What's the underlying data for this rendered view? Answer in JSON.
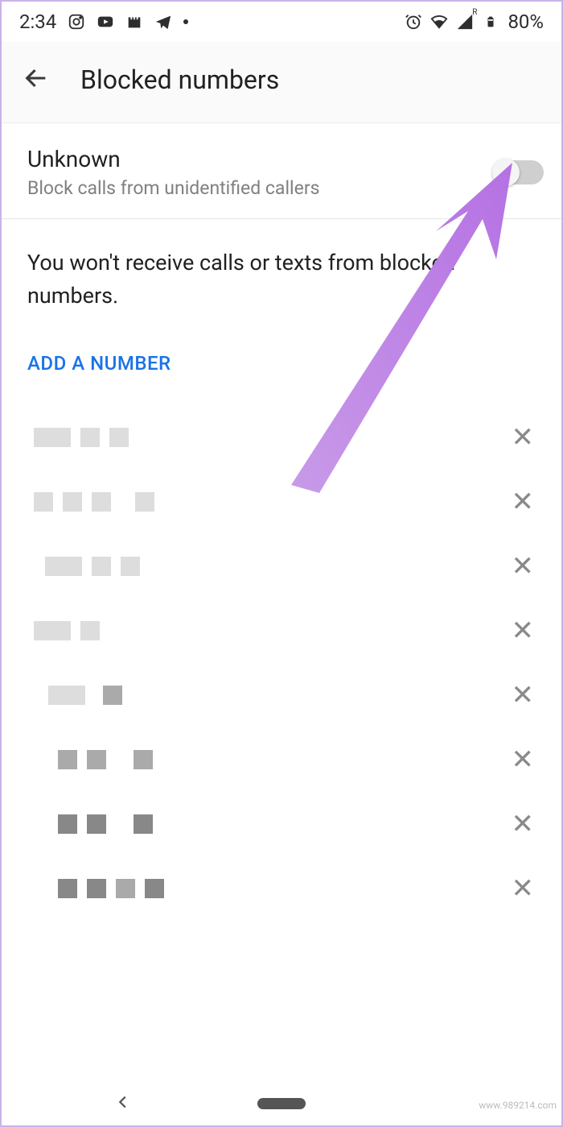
{
  "status": {
    "time": "2:34",
    "battery": "80%"
  },
  "header": {
    "title": "Blocked numbers"
  },
  "toggle": {
    "title": "Unknown",
    "subtitle": "Block calls from unidentified callers"
  },
  "info": "You won't receive calls or texts from blocked numbers.",
  "add_label": "ADD A NUMBER",
  "watermark": "www.989214.com"
}
